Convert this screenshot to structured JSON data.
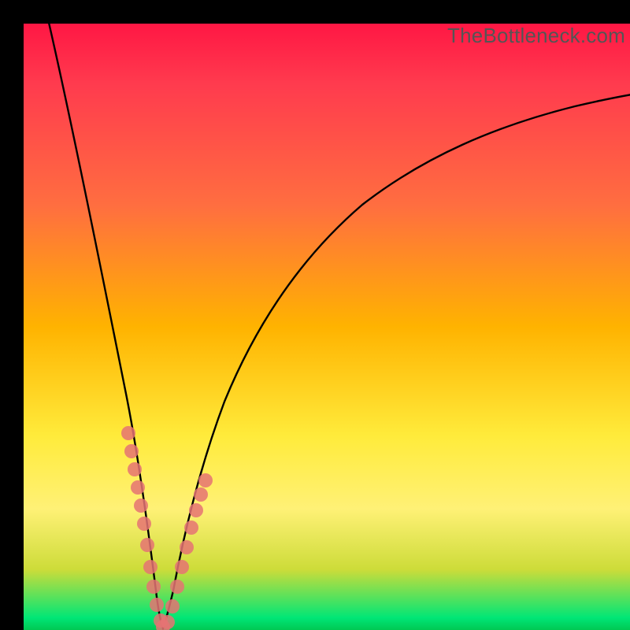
{
  "watermark": "TheBottleneck.com",
  "colors": {
    "bg_frame": "#000000",
    "gradient_top": "#ff1744",
    "gradient_mid1": "#ff6e40",
    "gradient_mid2": "#ffeb3b",
    "gradient_bottom": "#00c853",
    "curve_stroke": "#000000",
    "marker_fill": "#e57373"
  },
  "chart_data": {
    "type": "line",
    "title": "",
    "xlabel": "",
    "ylabel": "",
    "xlim": [
      0,
      100
    ],
    "ylim": [
      0,
      100
    ],
    "grid": false,
    "legend": false,
    "x": [
      4,
      6,
      8,
      10,
      12,
      14,
      16,
      18,
      19,
      20,
      21,
      22,
      23,
      24,
      25,
      26,
      28,
      30,
      32,
      36,
      40,
      44,
      48,
      52,
      56,
      60,
      64,
      68,
      72,
      76,
      80,
      84,
      88,
      92,
      96,
      100
    ],
    "y": [
      100,
      90,
      80,
      70,
      60,
      50,
      40,
      27,
      20,
      12,
      6,
      1,
      0,
      1,
      5,
      10,
      18,
      25,
      31,
      40,
      47,
      53,
      58,
      62,
      66,
      69,
      72,
      74,
      76,
      78,
      80,
      81,
      82,
      83,
      84,
      85
    ],
    "markers": {
      "x": [
        17.0,
        17.4,
        17.8,
        18.2,
        18.6,
        19.0,
        19.5,
        20.0,
        20.5,
        21.0,
        22.0,
        22.5,
        23.5,
        24.5,
        25.0,
        25.5,
        26.0,
        26.5,
        27.0,
        27.5,
        28.0
      ],
      "y": [
        33,
        30,
        28,
        25,
        22,
        19,
        15,
        11,
        8,
        5,
        1,
        0,
        0,
        3,
        6,
        9,
        12,
        15,
        18,
        20,
        22
      ],
      "note": "approximate cluster of salmon marker dots along lower portion of V-curve"
    }
  }
}
